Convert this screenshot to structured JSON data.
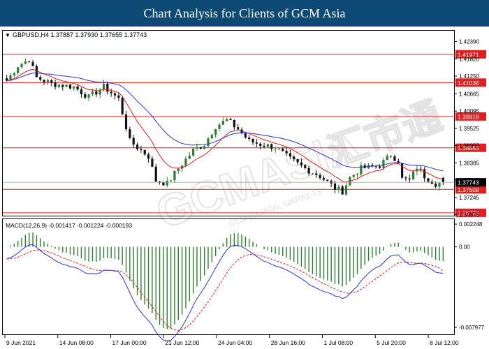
{
  "header": {
    "title": "Chart Analysis for Clients of GCM Asia"
  },
  "watermark": {
    "text": "GCMASIA",
    "chinese": "汇市通",
    "subtext": "GCM CAPITAL MARKETS"
  },
  "colors": {
    "border": "#000000",
    "bull": "#2e7d32",
    "bear": "#111111",
    "ema_fast": "#e02020",
    "ema_slow": "#2a34d8",
    "level": "#e02020",
    "label_bg": "#e02020",
    "price_box": "#000000",
    "macd_line": "#2a34d8",
    "macd_signal": "#e02020",
    "macd_hist": "#2e7d32"
  },
  "chart_data": [
    {
      "type": "candlestick",
      "symbol_label": "GBPUSD,H4 1.37887 1.37930 1.37655 1.37743",
      "timeframe": "H4",
      "ohlc_last": {
        "open": 1.37887,
        "high": 1.3793,
        "low": 1.37655,
        "close": 1.37743
      },
      "current_price_label": "1.37743",
      "ylim": [
        1.3664,
        1.4275
      ],
      "y_ticks": [
        "1.42390",
        "1.41820",
        "1.41250",
        "1.40665",
        "1.40095",
        "1.39525",
        "1.38955",
        "1.38385",
        "1.37815",
        "1.37245",
        "1.36675"
      ],
      "x_ticks": [
        "9 Jun 2021",
        "14 Jun 08:00",
        "17 Jun 00:00",
        "21 Jun 12:00",
        "24 Jun 04:00",
        "28 Jun 16:00",
        "1 Jul 08:00",
        "5 Jul 20:00",
        "8 Jul 12:00"
      ],
      "levels": [
        {
          "value": 1.41971,
          "label": "1.41971"
        },
        {
          "value": 1.41036,
          "label": "1.41036"
        },
        {
          "value": 1.39918,
          "label": "1.39918"
        },
        {
          "value": 1.38883,
          "label": "1.38883"
        },
        {
          "value": 1.37509,
          "label": "1.37509"
        },
        {
          "value": 1.36736,
          "label": "1.36736"
        }
      ],
      "path_anchors": [
        [
          0,
          1.411
        ],
        [
          3,
          1.416
        ],
        [
          6,
          1.418
        ],
        [
          8,
          1.412
        ],
        [
          12,
          1.41
        ],
        [
          18,
          1.409
        ],
        [
          22,
          1.4055
        ],
        [
          26,
          1.409
        ],
        [
          30,
          1.405
        ],
        [
          33,
          1.391
        ],
        [
          36,
          1.388
        ],
        [
          38,
          1.386
        ],
        [
          40,
          1.378
        ],
        [
          43,
          1.377
        ],
        [
          46,
          1.382
        ],
        [
          50,
          1.388
        ],
        [
          53,
          1.39
        ],
        [
          56,
          1.396
        ],
        [
          59,
          1.398
        ],
        [
          62,
          1.395
        ],
        [
          65,
          1.391
        ],
        [
          68,
          1.39
        ],
        [
          72,
          1.389
        ],
        [
          76,
          1.385
        ],
        [
          80,
          1.382
        ],
        [
          84,
          1.3795
        ],
        [
          88,
          1.3755
        ],
        [
          90,
          1.3745
        ],
        [
          92,
          1.379
        ],
        [
          95,
          1.382
        ],
        [
          98,
          1.3825
        ],
        [
          100,
          1.383
        ],
        [
          103,
          1.3865
        ],
        [
          105,
          1.3845
        ],
        [
          106,
          1.3785
        ],
        [
          108,
          1.378
        ],
        [
          110,
          1.3825
        ],
        [
          112,
          1.3795
        ],
        [
          115,
          1.377
        ],
        [
          118,
          1.3774
        ]
      ],
      "candle_count": 118,
      "indicators": [
        "EMA fast (red)",
        "EMA slow (blue)"
      ]
    },
    {
      "type": "macd",
      "label": "MACD(12,26,9) -0.001417 -0.001224 -0.000193",
      "params": [
        12,
        26,
        9
      ],
      "values": {
        "macd": -0.001417,
        "signal": -0.001224,
        "histogram": -0.000193
      },
      "y_ticks": [
        "0.002248",
        "0.00",
        "-0.007977"
      ],
      "ylim": [
        -0.0086,
        0.0026
      ]
    }
  ]
}
